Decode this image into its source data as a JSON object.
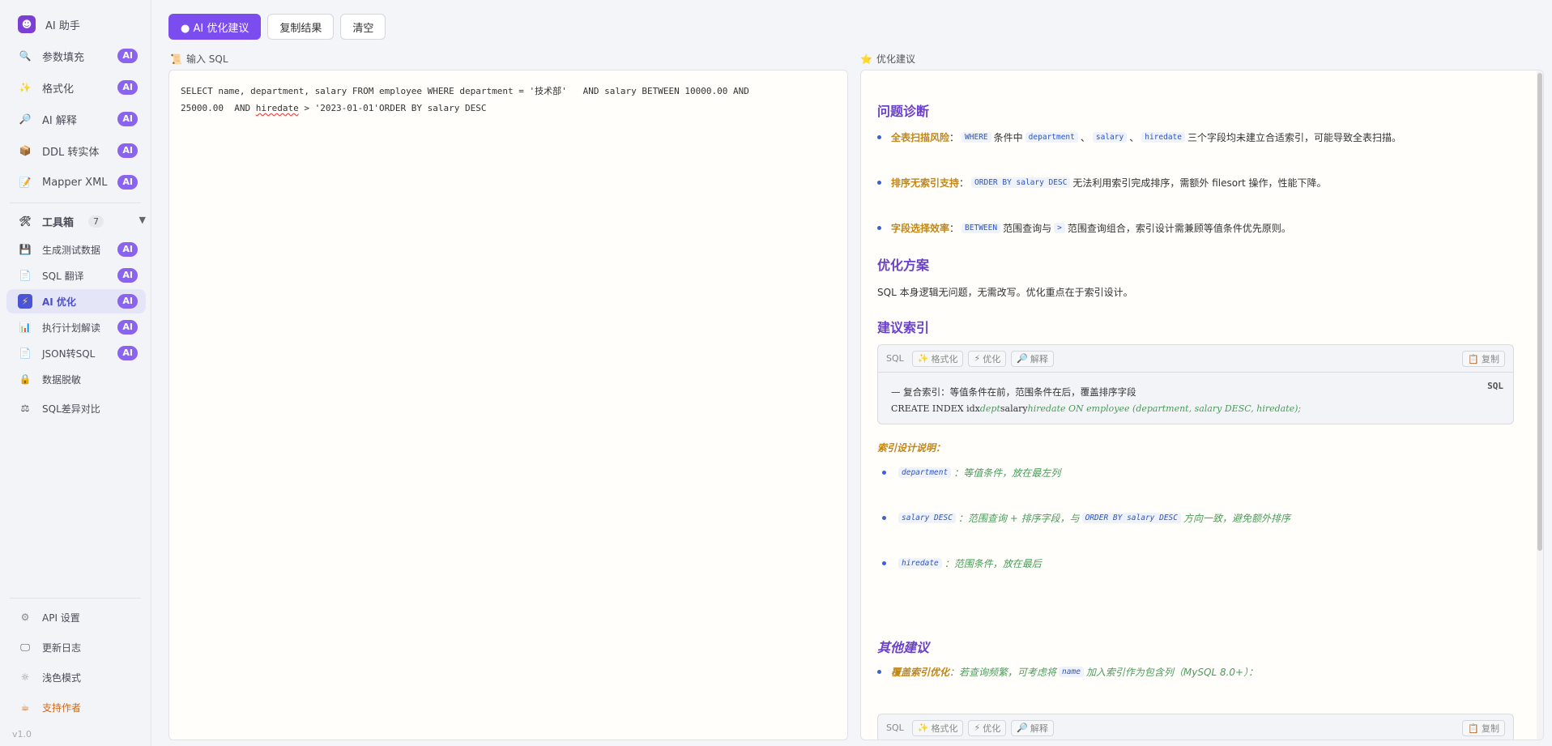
{
  "sidebar": {
    "brand": "AI 助手",
    "badge": "AI",
    "items": [
      {
        "label": "参数填充",
        "icon": "search-icon",
        "glyph": "🔍"
      },
      {
        "label": "格式化",
        "icon": "format-icon",
        "glyph": "✨"
      },
      {
        "label": "AI 解释",
        "icon": "magnifier-icon",
        "glyph": "🔎"
      },
      {
        "label": "DDL 转实体",
        "icon": "box-icon",
        "glyph": "📦"
      },
      {
        "label": "Mapper XML",
        "icon": "note-icon",
        "glyph": "📝"
      }
    ],
    "toolbox": {
      "label": "工具箱",
      "count": "7",
      "icon": "tools-icon",
      "glyph": "🛠"
    },
    "tools": [
      {
        "label": "生成测试数据",
        "icon": "floppy-icon",
        "glyph": "💾",
        "ai": true
      },
      {
        "label": "SQL 翻译",
        "icon": "page-icon",
        "glyph": "📄",
        "ai": true
      },
      {
        "label": "AI 优化",
        "icon": "lightning-icon",
        "glyph": "⚡",
        "ai": true
      },
      {
        "label": "执行计划解读",
        "icon": "chart-icon",
        "glyph": "📊",
        "ai": true
      },
      {
        "label": "JSON转SQL",
        "icon": "doc-icon",
        "glyph": "📄",
        "ai": true
      },
      {
        "label": "数据脱敏",
        "icon": "lock-icon",
        "glyph": "🔒",
        "ai": false
      },
      {
        "label": "SQL差异对比",
        "icon": "compare-icon",
        "glyph": "⚖",
        "ai": false
      }
    ],
    "bottom": [
      {
        "label": "API 设置",
        "icon": "gear-icon",
        "glyph": "⚙"
      },
      {
        "label": "更新日志",
        "icon": "monitor-icon",
        "glyph": "🖵"
      },
      {
        "label": "浅色模式",
        "icon": "sun-icon",
        "glyph": "☼"
      },
      {
        "label": "支持作者",
        "icon": "coffee-icon",
        "glyph": "☕"
      }
    ],
    "version": "v1.0"
  },
  "toolbar": {
    "optimize_label": "● AI 优化建议",
    "copy_label": "复制结果",
    "clear_label": "清空"
  },
  "input": {
    "title": "输入 SQL",
    "sql_part1": "SELECT name, department, salary FROM employee WHERE department = '技术部'   AND salary BETWEEN 10000.00 AND\n25000.00  AND ",
    "sql_squiggle": "hiredate",
    "sql_part2": " > '2023-01-01'ORDER BY salary DESC"
  },
  "output": {
    "title": "优化建议",
    "diag_heading": "问题诊断",
    "diag1": {
      "kw": "全表扫描风险",
      "c1": "WHERE",
      "t1": "条件中",
      "c2": "department",
      "c3": "salary",
      "c4": "hiredate",
      "t2": "三个字段均未建立合适索引，可能导致全表扫描。"
    },
    "diag2": {
      "kw": "排序无索引支持",
      "c1": "ORDER BY salary DESC",
      "t1": "无法利用索引完成排序，需额外 filesort 操作，性能下降。"
    },
    "diag3": {
      "kw": "字段选择效率",
      "c1": "BETWEEN",
      "t1": "范围查询与",
      "c2": ">",
      "t2": "范围查询组合，索引设计需兼顾等值条件优先原则。"
    },
    "plan_heading": "优化方案",
    "plan_text": "SQL 本身逻辑无问题，无需改写。优化重点在于索引设计。",
    "index_heading": "建议索引",
    "code_block": {
      "lang": "SQL",
      "format": "格式化",
      "optimize": "优化",
      "explain": "解释",
      "copy": "复制",
      "tag": "SQL",
      "comment": "— 复合索引：等值条件在前，范围条件在后，覆盖排序字段",
      "stmt_a": "CREATE INDEX idx",
      "stmt_b": "dept",
      "stmt_c": "salary",
      "stmt_d": "hiredate ON employee (department, salary DESC, hiredate);"
    },
    "idx_note_title": "索引设计说明：",
    "idx1": {
      "c": "department",
      "t": "：等值条件，放在最左列"
    },
    "idx2": {
      "c": "salary DESC",
      "t1": "：范围查询 + 排序字段，与",
      "c2": "ORDER BY salary DESC",
      "t2": "方向一致，避免额外排序"
    },
    "idx3": {
      "c": "hiredate",
      "t": "：范围条件，放在最后"
    },
    "other_heading": "其他建议",
    "other1": {
      "kw": "覆盖索引优化",
      "t1": "：若查询频繁，可考虑将",
      "c": "name",
      "t2": "加入索引作为包含列（MySQL 8.0+）："
    }
  }
}
